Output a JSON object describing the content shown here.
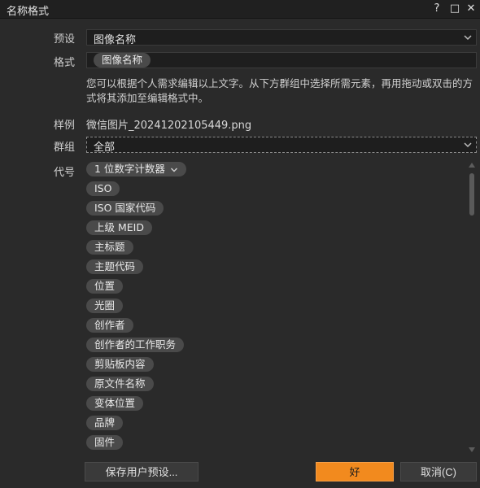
{
  "window": {
    "title": "名称格式",
    "help_glyph": "?",
    "maximize_glyph": "□",
    "close_glyph": "✕"
  },
  "preset": {
    "label": "预设",
    "value": "图像名称"
  },
  "format": {
    "label": "格式",
    "token": "图像名称"
  },
  "description": "您可以根据个人需求编辑以上文字。从下方群组中选择所需元素，再用拖动或双击的方式将其添加至编辑格式中。",
  "sample": {
    "label": "样例",
    "value": "微信图片_20241202105449.png"
  },
  "group": {
    "label": "群组",
    "value": "全部"
  },
  "codes": {
    "label": "代号",
    "items": [
      "1 位数字计数器",
      "ISO",
      "ISO 国家代码",
      "上级 MEID",
      "主标题",
      "主题代码",
      "位置",
      "光圈",
      "创作者",
      "创作者的工作职务",
      "剪贴板内容",
      "原文件名称",
      "变体位置",
      "品牌",
      "固件"
    ]
  },
  "buttons": {
    "save_preset": "保存用户预设...",
    "ok": "好",
    "cancel": "取消(C)"
  },
  "colors": {
    "accent": "#f28a1e",
    "background": "#2a2a2a",
    "token": "#4a4a4a"
  }
}
